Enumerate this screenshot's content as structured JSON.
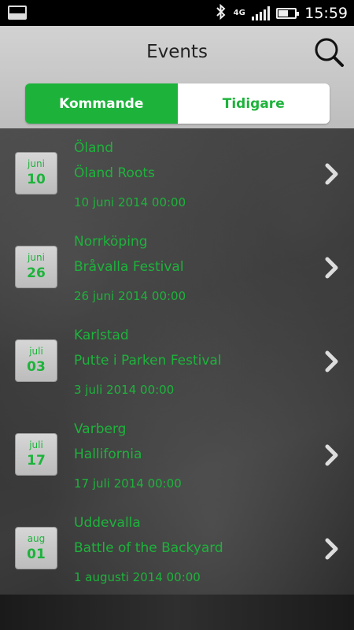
{
  "status_bar": {
    "network": "4G",
    "time": "15:59",
    "battery_level": 0.55
  },
  "header": {
    "title": "Events"
  },
  "tabs": [
    {
      "label": "Kommande",
      "active": true
    },
    {
      "label": "Tidigare",
      "active": false
    }
  ],
  "events": [
    {
      "month": "juni",
      "day": "10",
      "city": "Öland",
      "name": "Öland Roots",
      "datetime": "10 juni 2014 00:00"
    },
    {
      "month": "juni",
      "day": "26",
      "city": "Norrköping",
      "name": "Bråvalla Festival",
      "datetime": "26 juni 2014 00:00"
    },
    {
      "month": "juli",
      "day": "03",
      "city": "Karlstad",
      "name": "Putte i Parken Festival",
      "datetime": "3 juli 2014 00:00"
    },
    {
      "month": "juli",
      "day": "17",
      "city": "Varberg",
      "name": "Hallifornia",
      "datetime": "17 juli 2014 00:00"
    },
    {
      "month": "aug",
      "day": "01",
      "city": "Uddevalla",
      "name": "Battle of the Backyard",
      "datetime": "1 augusti 2014 00:00"
    }
  ],
  "colors": {
    "accent": "#1db33b",
    "header_bg": "#c8c8c8"
  }
}
